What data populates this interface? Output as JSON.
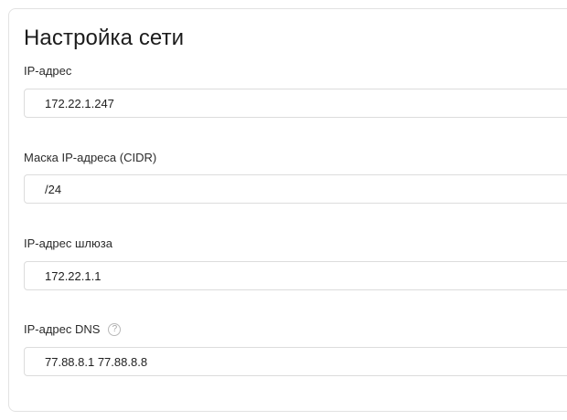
{
  "page": {
    "title": "Настройка сети"
  },
  "fields": {
    "ip": {
      "label": "IP-адрес",
      "value": "172.22.1.247"
    },
    "mask": {
      "label": "Маска IP-адреса (CIDR)",
      "value": "/24"
    },
    "gateway": {
      "label": "IP-адрес шлюза",
      "value": "172.22.1.1"
    },
    "dns": {
      "label": "IP-адрес DNS",
      "value": "77.88.8.1 77.88.8.8",
      "help_icon": "?"
    }
  }
}
